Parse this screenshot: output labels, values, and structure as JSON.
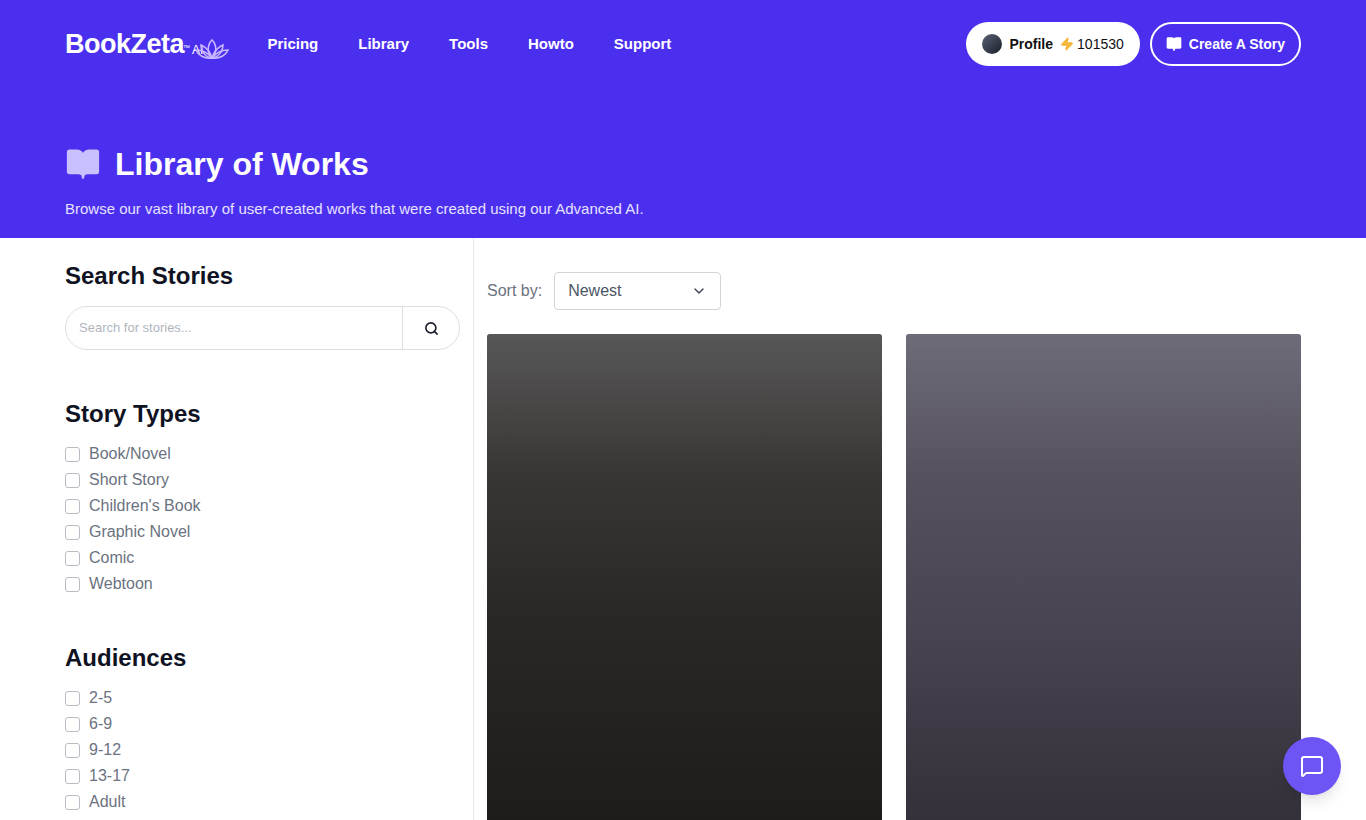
{
  "logo": {
    "name": "BookZeta",
    "tm": "™",
    "badge": "AI"
  },
  "nav": [
    "Pricing",
    "Library",
    "Tools",
    "Howto",
    "Support"
  ],
  "profile": {
    "label": "Profile",
    "credits": "101530"
  },
  "create_button": "Create A Story",
  "hero": {
    "title": "Library of Works",
    "subtitle": "Browse our vast library of user-created works that were created using our Advanced AI."
  },
  "search": {
    "title": "Search Stories",
    "placeholder": "Search for stories..."
  },
  "story_types": {
    "title": "Story Types",
    "items": [
      {
        "label": "Book/Novel",
        "checked": false
      },
      {
        "label": "Short Story",
        "checked": false
      },
      {
        "label": "Children's Book",
        "checked": false
      },
      {
        "label": "Graphic Novel",
        "checked": false
      },
      {
        "label": "Comic",
        "checked": false
      },
      {
        "label": "Webtoon",
        "checked": false
      }
    ]
  },
  "audiences": {
    "title": "Audiences",
    "items": [
      {
        "label": "2-5",
        "checked": false
      },
      {
        "label": "6-9",
        "checked": false
      },
      {
        "label": "9-12",
        "checked": false
      },
      {
        "label": "13-17",
        "checked": false
      },
      {
        "label": "Adult",
        "checked": false
      }
    ]
  },
  "sort": {
    "label": "Sort by:",
    "value": "Newest"
  },
  "stories": [
    {
      "color": "#2b2724"
    },
    {
      "color": "#4a4552"
    }
  ]
}
